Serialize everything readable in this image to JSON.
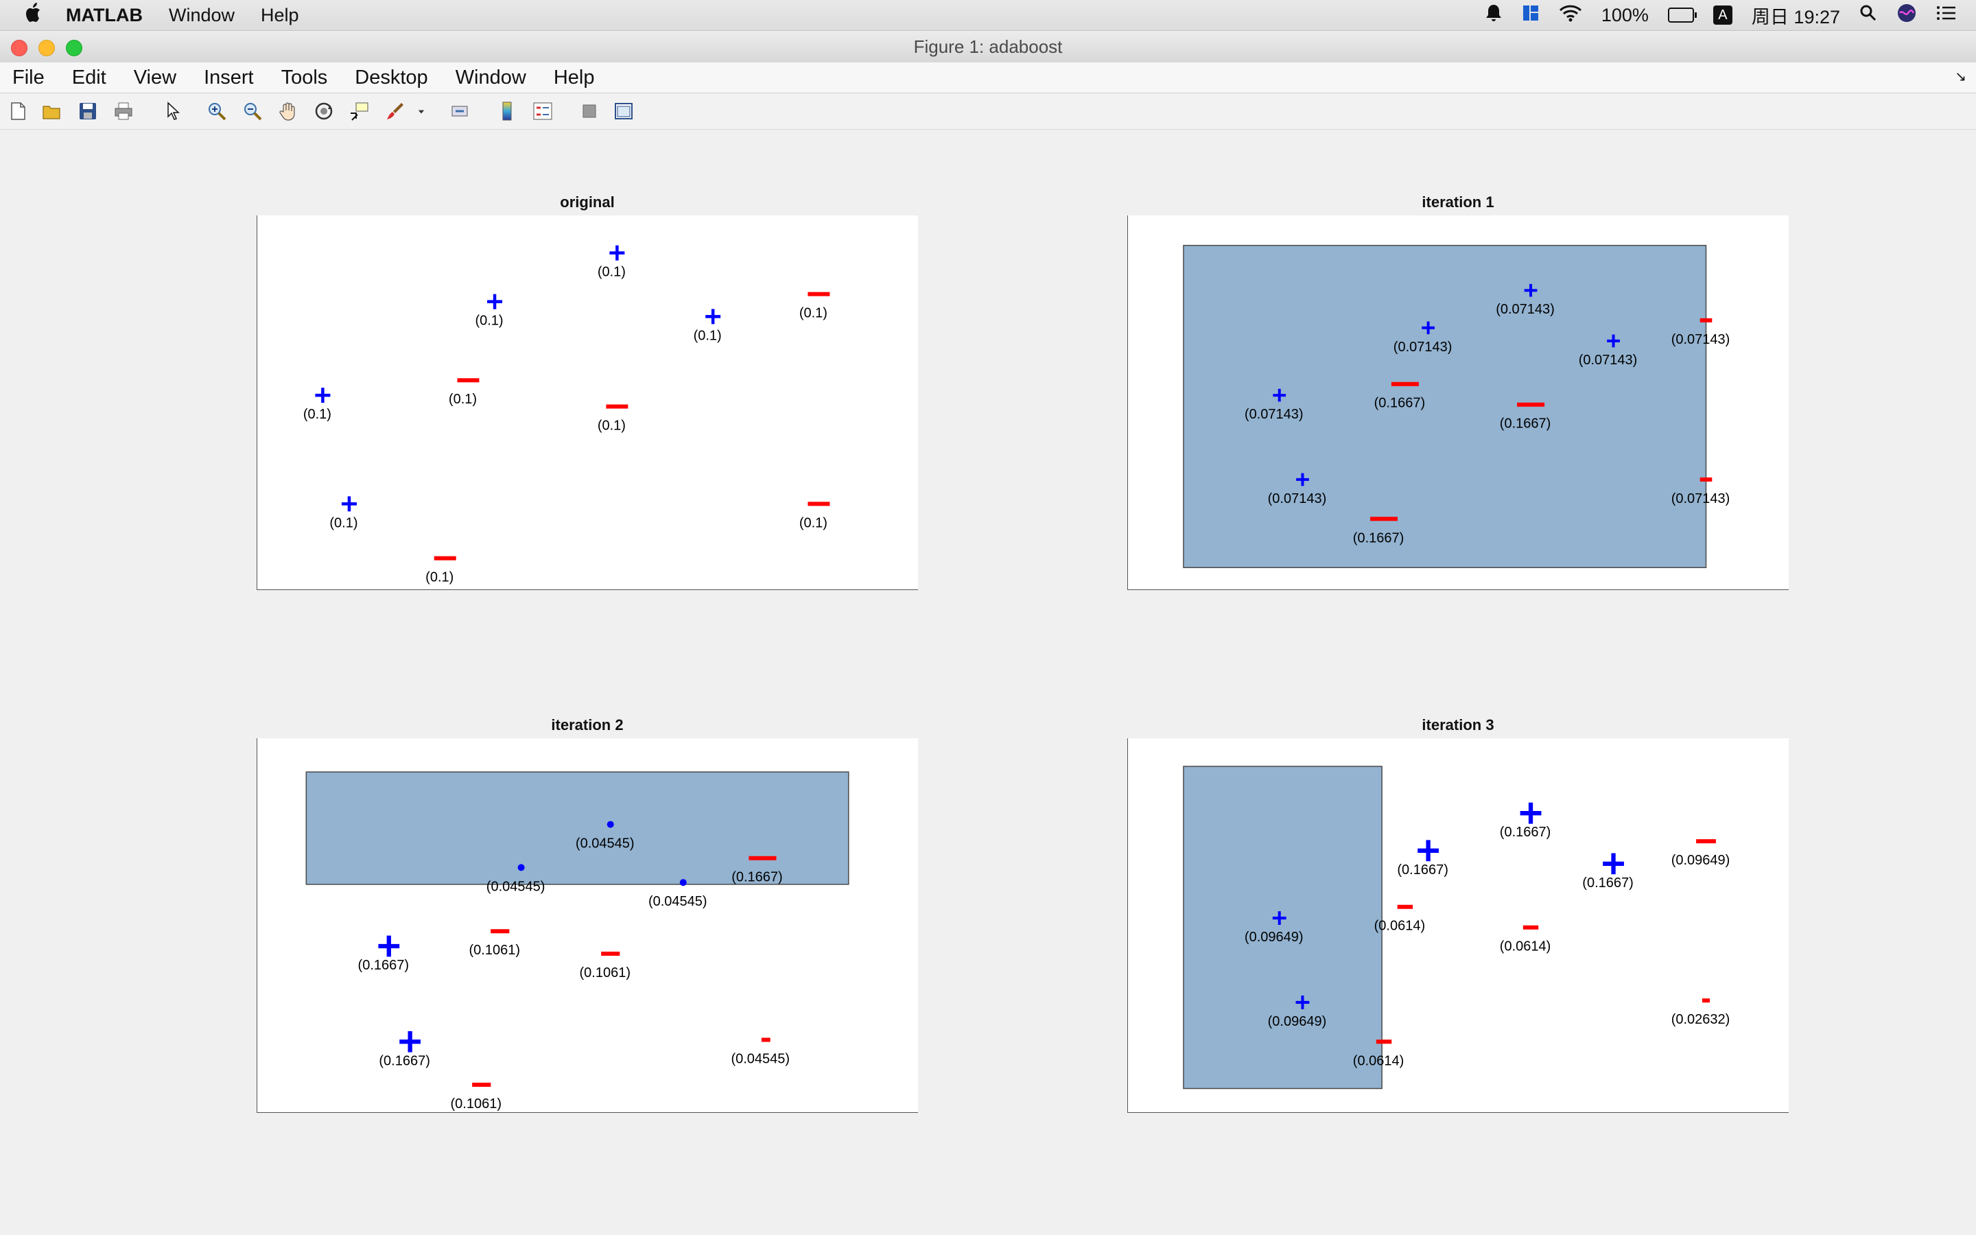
{
  "menubar": {
    "app_name": "MATLAB",
    "items": [
      "Window",
      "Help"
    ],
    "battery": "100%",
    "input_indicator": "A",
    "clock": "周日 19:27"
  },
  "window": {
    "title": "Figure 1: adaboost"
  },
  "figure_menu": {
    "items": [
      "File",
      "Edit",
      "View",
      "Insert",
      "Tools",
      "Desktop",
      "Window",
      "Help"
    ]
  },
  "toolbar": {
    "icons": [
      "new-figure-icon",
      "open-file-icon",
      "save-icon",
      "print-icon",
      "edit-plot-arrow-icon",
      "zoom-in-icon",
      "zoom-out-icon",
      "pan-hand-icon",
      "rotate-3d-icon",
      "data-cursor-icon",
      "brush-icon",
      "brush-dropdown-icon",
      "link-plot-icon",
      "colorbar-icon",
      "legend-icon",
      "hide-plot-tools-icon",
      "show-plot-tools-icon"
    ]
  },
  "colors": {
    "positive": "#0000ff",
    "negative": "#ff0000",
    "region_fill": "#93b3d0",
    "region_stroke": "#4a4a4a"
  },
  "chart_data": [
    {
      "type": "scatter",
      "title": "original",
      "axis_visible": false,
      "xlim": [
        0,
        1
      ],
      "ylim": [
        0,
        1
      ],
      "regions": [],
      "points": [
        {
          "x": 0.1,
          "y": 0.52,
          "cls": "+",
          "w": "(0.1)",
          "size": 1.0
        },
        {
          "x": 0.14,
          "y": 0.23,
          "cls": "+",
          "w": "(0.1)",
          "size": 1.0
        },
        {
          "x": 0.36,
          "y": 0.77,
          "cls": "+",
          "w": "(0.1)",
          "size": 1.0
        },
        {
          "x": 0.545,
          "y": 0.9,
          "cls": "+",
          "w": "(0.1)",
          "size": 1.0
        },
        {
          "x": 0.69,
          "y": 0.73,
          "cls": "+",
          "w": "(0.1)",
          "size": 1.0
        },
        {
          "x": 0.32,
          "y": 0.56,
          "cls": "-",
          "w": "(0.1)",
          "size": 1.0
        },
        {
          "x": 0.545,
          "y": 0.49,
          "cls": "-",
          "w": "(0.1)",
          "size": 1.0
        },
        {
          "x": 0.85,
          "y": 0.79,
          "cls": "-",
          "w": "(0.1)",
          "size": 1.0
        },
        {
          "x": 0.85,
          "y": 0.23,
          "cls": "-",
          "w": "(0.1)",
          "size": 1.0
        },
        {
          "x": 0.285,
          "y": 0.085,
          "cls": "-",
          "w": "(0.1)",
          "size": 1.0
        }
      ]
    },
    {
      "type": "scatter",
      "title": "iteration  1",
      "axis_visible": false,
      "xlim": [
        0,
        1
      ],
      "ylim": [
        0,
        1
      ],
      "regions": [
        {
          "x0": 0.085,
          "x1": 0.875,
          "y0": 0.06,
          "y1": 0.92
        }
      ],
      "points": [
        {
          "x": 0.23,
          "y": 0.52,
          "cls": "+",
          "w": "(0.07143)",
          "size": 0.85
        },
        {
          "x": 0.265,
          "y": 0.295,
          "cls": "+",
          "w": "(0.07143)",
          "size": 0.85
        },
        {
          "x": 0.455,
          "y": 0.7,
          "cls": "+",
          "w": "(0.07143)",
          "size": 0.85
        },
        {
          "x": 0.61,
          "y": 0.8,
          "cls": "+",
          "w": "(0.07143)",
          "size": 0.85
        },
        {
          "x": 0.735,
          "y": 0.665,
          "cls": "+",
          "w": "(0.07143)",
          "size": 0.85
        },
        {
          "x": 0.42,
          "y": 0.55,
          "cls": "-",
          "w": "(0.1667)",
          "size": 1.25
        },
        {
          "x": 0.61,
          "y": 0.495,
          "cls": "-",
          "w": "(0.1667)",
          "size": 1.25
        },
        {
          "x": 0.388,
          "y": 0.19,
          "cls": "-",
          "w": "(0.1667)",
          "size": 1.25
        },
        {
          "x": 0.875,
          "y": 0.72,
          "cls": "-",
          "w": "(0.07143)",
          "size": 0.55
        },
        {
          "x": 0.875,
          "y": 0.295,
          "cls": "-",
          "w": "(0.07143)",
          "size": 0.55
        }
      ]
    },
    {
      "type": "scatter",
      "title": "iteration  2",
      "axis_visible": false,
      "xlim": [
        0,
        1
      ],
      "ylim": [
        0,
        1
      ],
      "regions": [
        {
          "x0": 0.075,
          "x1": 0.895,
          "y0": 0.61,
          "y1": 0.91
        }
      ],
      "points": [
        {
          "x": 0.4,
          "y": 0.655,
          "cls": "+",
          "w": "(0.04545)",
          "size": 0.3
        },
        {
          "x": 0.535,
          "y": 0.77,
          "cls": "+",
          "w": "(0.04545)",
          "size": 0.3
        },
        {
          "x": 0.645,
          "y": 0.615,
          "cls": "+",
          "w": "(0.04545)",
          "size": 0.3
        },
        {
          "x": 0.2,
          "y": 0.445,
          "cls": "+",
          "w": "(0.1667)",
          "size": 1.4
        },
        {
          "x": 0.232,
          "y": 0.19,
          "cls": "+",
          "w": "(0.1667)",
          "size": 1.4
        },
        {
          "x": 0.765,
          "y": 0.68,
          "cls": "-",
          "w": "(0.1667)",
          "size": 1.25
        },
        {
          "x": 0.368,
          "y": 0.485,
          "cls": "-",
          "w": "(0.1061)",
          "size": 0.85
        },
        {
          "x": 0.535,
          "y": 0.425,
          "cls": "-",
          "w": "(0.1061)",
          "size": 0.85
        },
        {
          "x": 0.34,
          "y": 0.075,
          "cls": "-",
          "w": "(0.1061)",
          "size": 0.85
        },
        {
          "x": 0.77,
          "y": 0.195,
          "cls": "-",
          "w": "(0.04545)",
          "size": 0.4
        }
      ]
    },
    {
      "type": "scatter",
      "title": "iteration  3",
      "axis_visible": false,
      "xlim": [
        0,
        1
      ],
      "ylim": [
        0,
        1
      ],
      "regions": [
        {
          "x0": 0.085,
          "x1": 0.385,
          "y0": 0.065,
          "y1": 0.925
        }
      ],
      "points": [
        {
          "x": 0.23,
          "y": 0.52,
          "cls": "+",
          "w": "(0.09649)",
          "size": 0.9
        },
        {
          "x": 0.265,
          "y": 0.295,
          "cls": "+",
          "w": "(0.09649)",
          "size": 0.9
        },
        {
          "x": 0.455,
          "y": 0.7,
          "cls": "+",
          "w": "(0.1667)",
          "size": 1.4
        },
        {
          "x": 0.61,
          "y": 0.8,
          "cls": "+",
          "w": "(0.1667)",
          "size": 1.4
        },
        {
          "x": 0.735,
          "y": 0.665,
          "cls": "+",
          "w": "(0.1667)",
          "size": 1.4
        },
        {
          "x": 0.42,
          "y": 0.55,
          "cls": "-",
          "w": "(0.0614)",
          "size": 0.7
        },
        {
          "x": 0.61,
          "y": 0.495,
          "cls": "-",
          "w": "(0.0614)",
          "size": 0.7
        },
        {
          "x": 0.388,
          "y": 0.19,
          "cls": "-",
          "w": "(0.0614)",
          "size": 0.7
        },
        {
          "x": 0.875,
          "y": 0.725,
          "cls": "-",
          "w": "(0.09649)",
          "size": 0.9
        },
        {
          "x": 0.875,
          "y": 0.3,
          "cls": "-",
          "w": "(0.02632)",
          "size": 0.35
        }
      ]
    }
  ]
}
